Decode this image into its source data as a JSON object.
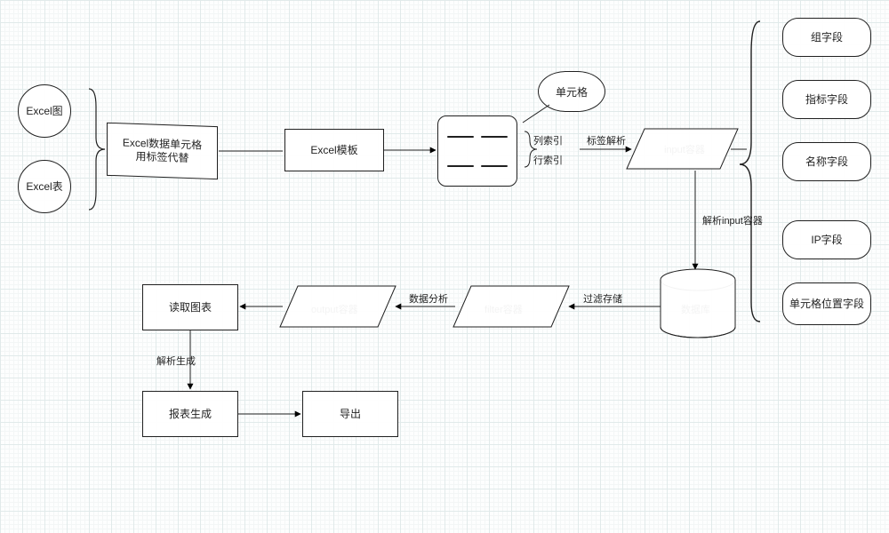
{
  "nodes": {
    "excel_image": "Excel图",
    "excel_table": "Excel表",
    "data_cell_tag": "Excel数据单元格\n用标签代替",
    "excel_template": "Excel模板",
    "cell_callout": "单元格",
    "input_container": "input容器",
    "database": "数据库",
    "filter_container": "filter容器",
    "output_container": "output容器",
    "read_chart": "读取图表",
    "report_gen": "报表生成",
    "export": "导出",
    "field_group": "组字段",
    "field_metric": "指标字段",
    "field_name": "名称字段",
    "field_ip": "IP字段",
    "field_cellpos": "单元格位置字段"
  },
  "edges": {
    "col_index": "列索引",
    "row_index": "行索引",
    "tag_parse": "标签解析",
    "parse_input": "解析input容器",
    "filter_store": "过滤存储",
    "data_analysis": "数据分析",
    "parse_generate": "解析生成"
  },
  "braces": {
    "left": "}",
    "right": "{"
  }
}
